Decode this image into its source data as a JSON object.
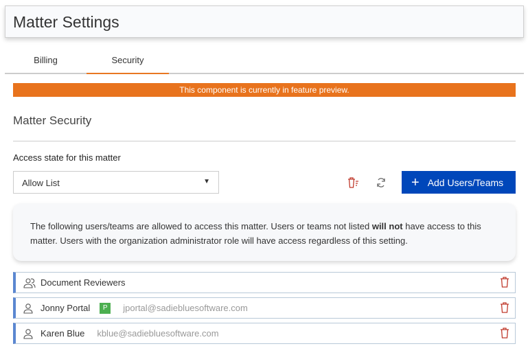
{
  "header": {
    "title": "Matter Settings"
  },
  "tabs": [
    {
      "label": "Billing",
      "active": false
    },
    {
      "label": "Security",
      "active": true
    }
  ],
  "banner": {
    "text": "This component is currently in feature preview.",
    "color": "#e8731d"
  },
  "section": {
    "title": "Matter Security"
  },
  "access": {
    "label": "Access state for this matter",
    "selected": "Allow List"
  },
  "toolbar": {
    "clear_icon": "trash-list-icon",
    "refresh_icon": "refresh-icon",
    "add_label": "Add Users/Teams",
    "accent": "#0047ba"
  },
  "info": {
    "before": "The following users/teams are allowed to access this matter. Users or teams not listed ",
    "bold": "will not",
    "after": " have access to this matter. Users with the organization administrator role will have access regardless of this setting."
  },
  "entries": [
    {
      "type": "team",
      "name": "Document Reviewers",
      "badge": "",
      "email": ""
    },
    {
      "type": "user",
      "name": "Jonny Portal",
      "badge": "P",
      "email": "jportal@sadiebluesoftware.com"
    },
    {
      "type": "user",
      "name": "Karen Blue",
      "badge": "",
      "email": "kblue@sadiebluesoftware.com"
    }
  ]
}
